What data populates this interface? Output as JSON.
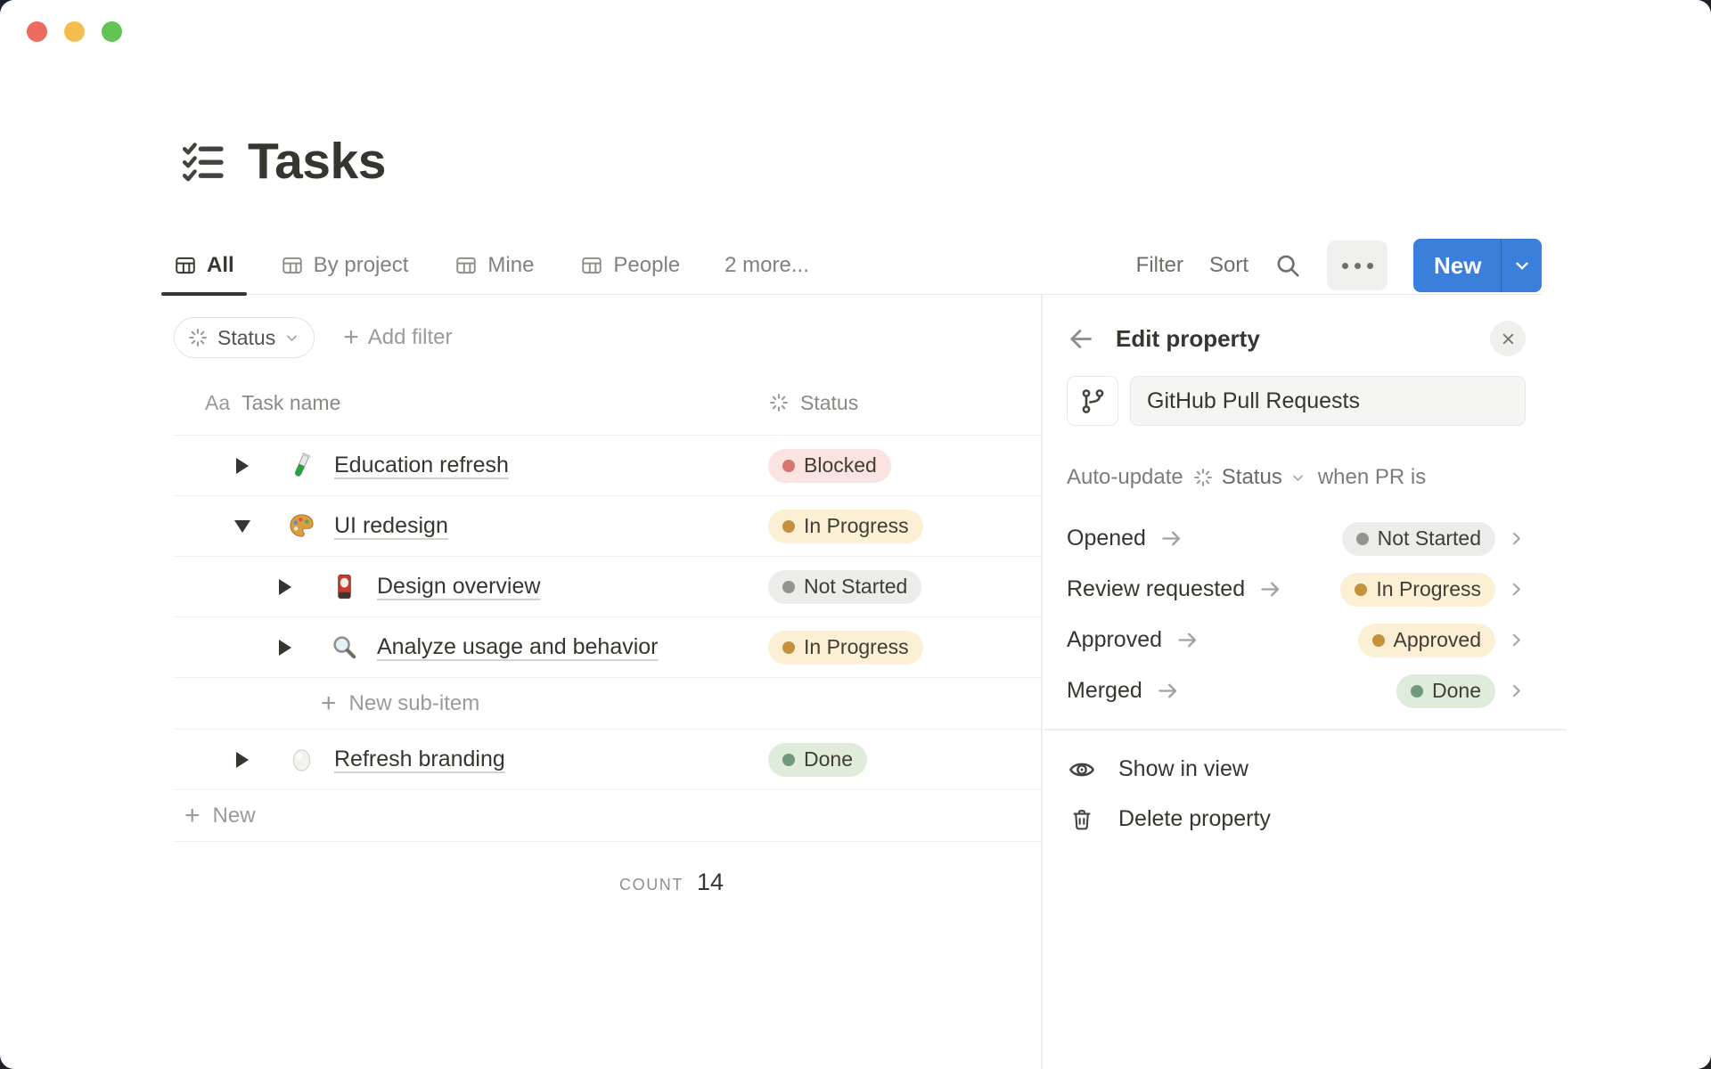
{
  "window": {
    "title": "Tasks",
    "title_icon": "checklist"
  },
  "tabs": {
    "items": [
      {
        "label": "All",
        "active": true
      },
      {
        "label": "By project",
        "active": false
      },
      {
        "label": "Mine",
        "active": false
      },
      {
        "label": "People",
        "active": false
      }
    ],
    "more_label": "2 more..."
  },
  "toolbar": {
    "filter_label": "Filter",
    "sort_label": "Sort",
    "new_label": "New"
  },
  "filter_bar": {
    "status_label": "Status",
    "add_filter_label": "Add filter"
  },
  "table": {
    "columns": [
      {
        "label": "Task name",
        "type_glyph": "Aa"
      },
      {
        "label": "Status",
        "icon": "status-spinner"
      }
    ],
    "rows": [
      {
        "type": "task",
        "title": "Education refresh",
        "icon": "test-tube",
        "status": "Blocked",
        "level": 0,
        "expanded": false
      },
      {
        "type": "task",
        "title": "UI redesign",
        "icon": "palette",
        "status": "In Progress",
        "level": 0,
        "expanded": true
      },
      {
        "type": "task",
        "title": "Design overview",
        "icon": "flower-card",
        "status": "Not Started",
        "level": 1,
        "expanded": false
      },
      {
        "type": "task",
        "title": "Analyze usage and behavior",
        "icon": "magnifier",
        "status": "In Progress",
        "level": 1,
        "expanded": false
      },
      {
        "type": "action",
        "name": "new-sub-item-row",
        "label": "New sub-item",
        "indent": true
      },
      {
        "type": "task",
        "title": "Refresh branding",
        "icon": "egg",
        "status": "Done",
        "level": 0,
        "expanded": false
      },
      {
        "type": "action",
        "name": "new-row",
        "label": "New",
        "indent": false
      }
    ],
    "count_label": "COUNT",
    "count_value": "14"
  },
  "status_styles": {
    "Blocked": {
      "bg": "#fae3e0",
      "dot": "#d6756c"
    },
    "In Progress": {
      "bg": "#fbf0d3",
      "dot": "#c5913d"
    },
    "Not Started": {
      "bg": "#ececea",
      "dot": "#949391"
    },
    "Approved": {
      "bg": "#fbf0d3",
      "dot": "#c5913d"
    },
    "Done": {
      "bg": "#dfecdc",
      "dot": "#70987b"
    }
  },
  "panel": {
    "title": "Edit property",
    "property_icon": "git-branch",
    "property_name": "GitHub Pull Requests",
    "auto_update": {
      "prefix": "Auto-update",
      "property": "Status",
      "suffix": "when PR is"
    },
    "mappings": [
      {
        "event": "Opened",
        "status": "Not Started"
      },
      {
        "event": "Review requested",
        "status": "In Progress"
      },
      {
        "event": "Approved",
        "status": "Approved"
      },
      {
        "event": "Merged",
        "status": "Done"
      }
    ],
    "actions": [
      {
        "label": "Show in view",
        "icon": "eye",
        "name": "show-in-view-button"
      },
      {
        "label": "Delete property",
        "icon": "trash",
        "name": "delete-property-button"
      }
    ]
  },
  "colors": {
    "accent_blue": "#3a80db"
  }
}
